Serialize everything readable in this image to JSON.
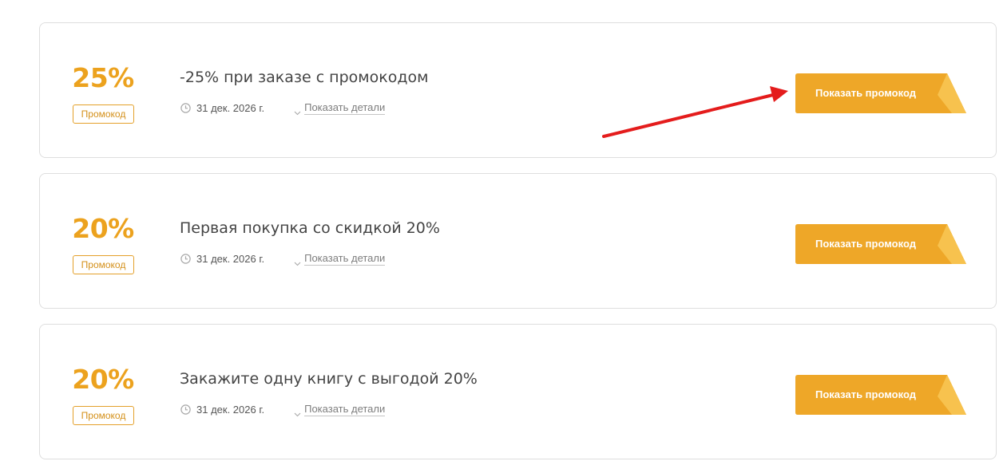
{
  "offers": [
    {
      "discount": "25%",
      "type": "Промокод",
      "title": "-25% при заказе с промокодом",
      "date": "31 дек. 2026 г.",
      "details_label": "Показать детали",
      "button_label": "Показать промокод"
    },
    {
      "discount": "20%",
      "type": "Промокод",
      "title": "Первая покупка со скидкой 20%",
      "date": "31 дек. 2026 г.",
      "details_label": "Показать детали",
      "button_label": "Показать промокод"
    },
    {
      "discount": "20%",
      "type": "Промокод",
      "title": "Закажите одну книгу с выгодой 20%",
      "date": "31 дек. 2026 г.",
      "details_label": "Показать детали",
      "button_label": "Показать промокод"
    }
  ],
  "icons": {
    "date": "clock-icon",
    "details": "chevron-down-icon",
    "button_corner": "folded-corner-icon",
    "annotation": "red-arrow"
  },
  "colors": {
    "accent": "#eca21e",
    "button": "#eea728",
    "button_fold": "#f7c24e",
    "arrow": "#e41c1c",
    "card_border": "#dedede"
  }
}
